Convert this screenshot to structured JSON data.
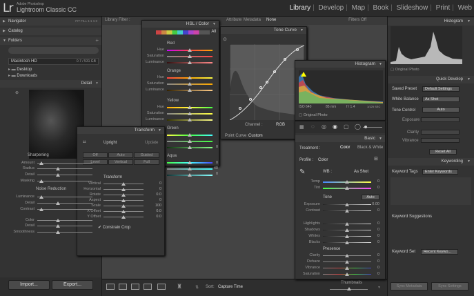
{
  "app": {
    "logo_mark": "Lr",
    "vendor": "Adobe Photoshop",
    "name": "Lightroom Classic CC"
  },
  "modules": [
    "Library",
    "Develop",
    "Map",
    "Book",
    "Slideshow",
    "Print",
    "Web"
  ],
  "active_module": "Library",
  "left": {
    "navigator": "Navigator",
    "nav_modes": "FIT  FILL  1:1  1:3",
    "catalog": "Catalog",
    "folders": "Folders",
    "folders_add": "+",
    "disk_name": "Macintosh HD",
    "disk_space": "0.7 / 531 GB",
    "folder_items": [
      {
        "name": "Desktop",
        "count": "29"
      },
      {
        "name": "Downloads",
        "count": "30"
      }
    ],
    "detail": "Detail",
    "sharpening": "Sharpening",
    "sharpen_sliders": [
      {
        "label": "Amount",
        "val": ""
      },
      {
        "label": "Radius",
        "val": ""
      },
      {
        "label": "Detail",
        "val": ""
      },
      {
        "label": "Masking",
        "val": ""
      }
    ],
    "noise_reduction": "Noise Reduction",
    "noise_sliders": [
      {
        "label": "Luminance",
        "val": ""
      },
      {
        "label": "Detail",
        "val": ""
      },
      {
        "label": "Contrast",
        "val": ""
      },
      {
        "label": "Color",
        "val": ""
      },
      {
        "label": "Detail",
        "val": ""
      },
      {
        "label": "Smoothness",
        "val": ""
      }
    ],
    "import_label": "Import...",
    "export_label": "Export..."
  },
  "center": {
    "filter_label": "Library Filter :",
    "filter_tabs": [
      "Text",
      "Attribute",
      "Metadata",
      "None"
    ],
    "filters_off": "Filters Off",
    "sort_label": "Sort:",
    "sort_value": "Capture Time",
    "thumbnails_label": "Thumbnails"
  },
  "hsl": {
    "title": "HSL / Color",
    "all_label": "All",
    "groups": [
      {
        "name": "Red",
        "rows": [
          "Hue",
          "Saturation",
          "Luminance"
        ]
      },
      {
        "name": "Orange",
        "rows": [
          "Hue",
          "Saturation",
          "Luminance"
        ]
      },
      {
        "name": "Yellow",
        "rows": [
          "Hue",
          "Saturation",
          "Luminance"
        ]
      },
      {
        "name": "Green",
        "rows": [
          "",
          "",
          ""
        ]
      },
      {
        "name": "Aqua",
        "rows": [
          "",
          "",
          ""
        ]
      }
    ],
    "vals": [
      "0",
      "0",
      "40",
      "0"
    ]
  },
  "tone_curve": {
    "title": "Tone Curve",
    "channel_label": "Channel :",
    "channel_value": "RGB",
    "point_curve_label": "Point Curve :",
    "point_curve_value": "Custom"
  },
  "transform": {
    "title": "Transform",
    "upright": "Upright",
    "update": "Update",
    "buttons": [
      "Off",
      "Auto",
      "Guided",
      "Level",
      "Vertical",
      "Full"
    ],
    "transform_label": "Transform",
    "sliders": [
      {
        "label": "Vertical",
        "val": "0"
      },
      {
        "label": "Horizontal",
        "val": "0"
      },
      {
        "label": "Rotate",
        "val": "0.0"
      },
      {
        "label": "Aspect",
        "val": "0"
      },
      {
        "label": "Scale",
        "val": "100"
      },
      {
        "label": "X Offset",
        "val": "0.0"
      },
      {
        "label": "Y Offset",
        "val": "0.0"
      }
    ],
    "constrain_crop": "Constrain Crop"
  },
  "histogram_float": {
    "title": "Histogram",
    "info": [
      "ISO 640",
      "85 mm",
      "f / 1.4",
      "1/125 SEC"
    ],
    "original_photo": "Original Photo"
  },
  "basic": {
    "title": "Basic",
    "treatment_label": "Treatment :",
    "color": "Color",
    "bw": "Black & White",
    "profile_label": "Profile :",
    "profile_value": "Color",
    "wb_label": "WB :",
    "wb_value": "As Shot",
    "wb_sliders": [
      {
        "label": "Temp",
        "val": "0"
      },
      {
        "label": "Tint",
        "val": "0"
      }
    ],
    "tone_label": "Tone",
    "tone_auto": "Auto",
    "tone_sliders": [
      {
        "label": "Exposure",
        "val": "0.00"
      },
      {
        "label": "Contrast",
        "val": "0"
      },
      {
        "label": "Highlights",
        "val": "0"
      },
      {
        "label": "Shadows",
        "val": "0"
      },
      {
        "label": "Whites",
        "val": "0"
      },
      {
        "label": "Blacks",
        "val": "0"
      }
    ],
    "presence_label": "Presence",
    "presence_sliders": [
      {
        "label": "Clarity",
        "val": "0"
      },
      {
        "label": "Dehaze",
        "val": "0"
      },
      {
        "label": "Vibrance",
        "val": "0"
      },
      {
        "label": "Saturation",
        "val": "0"
      }
    ]
  },
  "right": {
    "histogram": "Histogram",
    "original_photo": "Original Photo",
    "quick_develop": "Quick Develop",
    "saved_preset_label": "Saved Preset",
    "saved_preset_value": "Default Settings",
    "white_balance_label": "White Balance",
    "white_balance_value": "As Shot",
    "tone_control_label": "Tone Control",
    "auto": "Auto",
    "qd_rows": [
      "Exposure",
      "Clarity",
      "Vibrance"
    ],
    "reset_all": "Reset All",
    "keywording": "Keywording",
    "keyword_tags_label": "Keyword Tags",
    "keyword_tags_value": "Enter Keywords",
    "keyword_suggestions": "Keyword Suggestions",
    "keyword_set_label": "Keyword Set",
    "keyword_set_value": "Recent Keywo...",
    "sync_metadata": "Sync Metadata",
    "sync_settings": "Sync Settings"
  },
  "colors": {
    "accent": "#e6e6e6",
    "panel": "#333333"
  }
}
